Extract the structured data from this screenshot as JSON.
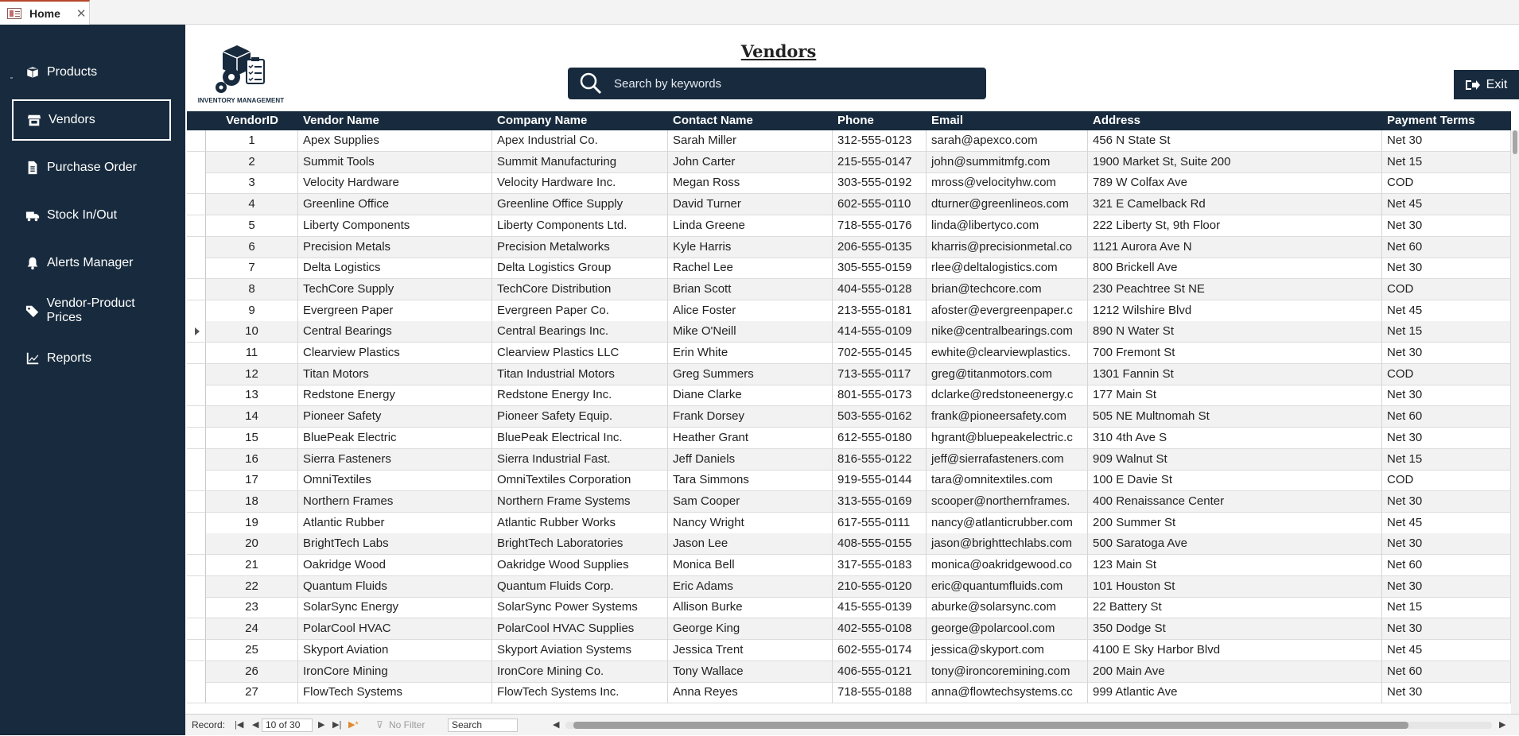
{
  "tab": {
    "label": "Home",
    "close": "✕"
  },
  "sidebar": {
    "items": [
      {
        "label": "Products",
        "icon": "box-icon"
      },
      {
        "label": "Vendors",
        "icon": "store-icon"
      },
      {
        "label": "Purchase Order",
        "icon": "document-icon"
      },
      {
        "label": "Stock In/Out",
        "icon": "truck-icon"
      },
      {
        "label": "Alerts Manager",
        "icon": "bell-icon"
      },
      {
        "label": "Vendor-Product Prices",
        "icon": "tags-icon"
      },
      {
        "label": "Reports",
        "icon": "chart-icon"
      }
    ]
  },
  "header": {
    "logo_text": "INVENTORY MANAGEMENT",
    "title": "Vendors",
    "search_placeholder": "Search by keywords",
    "exit_label": "Exit"
  },
  "table": {
    "columns": [
      "VendorID",
      "Vendor Name",
      "Company Name",
      "Contact Name",
      "Phone",
      "Email",
      "Address",
      "Payment Terms"
    ],
    "current_row": 10,
    "rows": [
      [
        "1",
        "Apex Supplies",
        "Apex Industrial Co.",
        "Sarah Miller",
        "312-555-0123",
        "sarah@apexco.com",
        "456 N State St",
        "Net 30"
      ],
      [
        "2",
        "Summit Tools",
        "Summit Manufacturing",
        "John Carter",
        "215-555-0147",
        "john@summitmfg.com",
        "1900 Market St, Suite 200",
        "Net 15"
      ],
      [
        "3",
        "Velocity Hardware",
        "Velocity Hardware Inc.",
        "Megan Ross",
        "303-555-0192",
        "mross@velocityhw.com",
        "789 W Colfax Ave",
        "COD"
      ],
      [
        "4",
        "Greenline Office",
        "Greenline Office Supply",
        "David Turner",
        "602-555-0110",
        "dturner@greenlineos.com",
        "321 E Camelback Rd",
        "Net 45"
      ],
      [
        "5",
        "Liberty Components",
        "Liberty Components Ltd.",
        "Linda Greene",
        "718-555-0176",
        "linda@libertyco.com",
        "222 Liberty St, 9th Floor",
        "Net 30"
      ],
      [
        "6",
        "Precision Metals",
        "Precision Metalworks",
        "Kyle Harris",
        "206-555-0135",
        "kharris@precisionmetal.co",
        "1121 Aurora Ave N",
        "Net 60"
      ],
      [
        "7",
        "Delta Logistics",
        "Delta Logistics Group",
        "Rachel Lee",
        "305-555-0159",
        "rlee@deltalogistics.com",
        "800 Brickell Ave",
        "Net 30"
      ],
      [
        "8",
        "TechCore Supply",
        "TechCore Distribution",
        "Brian Scott",
        "404-555-0128",
        "brian@techcore.com",
        "230 Peachtree St NE",
        "COD"
      ],
      [
        "9",
        "Evergreen Paper",
        "Evergreen Paper Co.",
        "Alice Foster",
        "213-555-0181",
        "afoster@evergreenpaper.c",
        "1212 Wilshire Blvd",
        "Net 45"
      ],
      [
        "10",
        "Central Bearings",
        "Central Bearings Inc.",
        "Mike O'Neill",
        "414-555-0109",
        "nike@centralbearings.com",
        "890 N Water St",
        "Net 15"
      ],
      [
        "11",
        "Clearview Plastics",
        "Clearview Plastics LLC",
        "Erin White",
        "702-555-0145",
        "ewhite@clearviewplastics.",
        "700 Fremont St",
        "Net 30"
      ],
      [
        "12",
        "Titan Motors",
        "Titan Industrial Motors",
        "Greg Summers",
        "713-555-0117",
        "greg@titanmotors.com",
        "1301 Fannin St",
        "COD"
      ],
      [
        "13",
        "Redstone Energy",
        "Redstone Energy Inc.",
        "Diane Clarke",
        "801-555-0173",
        "dclarke@redstoneenergy.c",
        "177 Main St",
        "Net 30"
      ],
      [
        "14",
        "Pioneer Safety",
        "Pioneer Safety Equip.",
        "Frank Dorsey",
        "503-555-0162",
        "frank@pioneersafety.com",
        "505 NE Multnomah St",
        "Net 60"
      ],
      [
        "15",
        "BluePeak Electric",
        "BluePeak Electrical Inc.",
        "Heather Grant",
        "612-555-0180",
        "hgrant@bluepeakelectric.c",
        "310 4th Ave S",
        "Net 30"
      ],
      [
        "16",
        "Sierra Fasteners",
        "Sierra Industrial Fast.",
        "Jeff Daniels",
        "816-555-0122",
        "jeff@sierrafasteners.com",
        "909 Walnut St",
        "Net 15"
      ],
      [
        "17",
        "OmniTextiles",
        "OmniTextiles Corporation",
        "Tara Simmons",
        "919-555-0144",
        "tara@omnitextiles.com",
        "100 E Davie St",
        "COD"
      ],
      [
        "18",
        "Northern Frames",
        "Northern Frame Systems",
        "Sam Cooper",
        "313-555-0169",
        "scooper@northernframes.",
        "400 Renaissance Center",
        "Net 30"
      ],
      [
        "19",
        "Atlantic Rubber",
        "Atlantic Rubber Works",
        "Nancy Wright",
        "617-555-0111",
        "nancy@atlanticrubber.com",
        "200 Summer St",
        "Net 45"
      ],
      [
        "20",
        "BrightTech Labs",
        "BrightTech Laboratories",
        "Jason Lee",
        "408-555-0155",
        "jason@brighttechlabs.com",
        "500 Saratoga Ave",
        "Net 30"
      ],
      [
        "21",
        "Oakridge Wood",
        "Oakridge Wood Supplies",
        "Monica Bell",
        "317-555-0183",
        "monica@oakridgewood.co",
        "123 Main St",
        "Net 60"
      ],
      [
        "22",
        "Quantum Fluids",
        "Quantum Fluids Corp.",
        "Eric Adams",
        "210-555-0120",
        "eric@quantumfluids.com",
        "101 Houston St",
        "Net 30"
      ],
      [
        "23",
        "SolarSync Energy",
        "SolarSync Power Systems",
        "Allison Burke",
        "415-555-0139",
        "aburke@solarsync.com",
        "22 Battery St",
        "Net 15"
      ],
      [
        "24",
        "PolarCool HVAC",
        "PolarCool HVAC Supplies",
        "George King",
        "402-555-0108",
        "george@polarcool.com",
        "350 Dodge St",
        "Net 30"
      ],
      [
        "25",
        "Skyport Aviation",
        "Skyport Aviation Systems",
        "Jessica Trent",
        "602-555-0174",
        "jessica@skyport.com",
        "4100 E Sky Harbor Blvd",
        "Net 45"
      ],
      [
        "26",
        "IronCore Mining",
        "IronCore Mining Co.",
        "Tony Wallace",
        "406-555-0121",
        "tony@ironcoremining.com",
        "200 Main Ave",
        "Net 60"
      ],
      [
        "27",
        "FlowTech Systems",
        "FlowTech Systems Inc.",
        "Anna Reyes",
        "718-555-0188",
        "anna@flowtechsystems.cc",
        "999 Atlantic Ave",
        "Net 30"
      ]
    ]
  },
  "statusbar": {
    "record_label": "Record:",
    "record_position": "10 of 30",
    "filter_label": "No Filter",
    "search_label": "Search"
  }
}
